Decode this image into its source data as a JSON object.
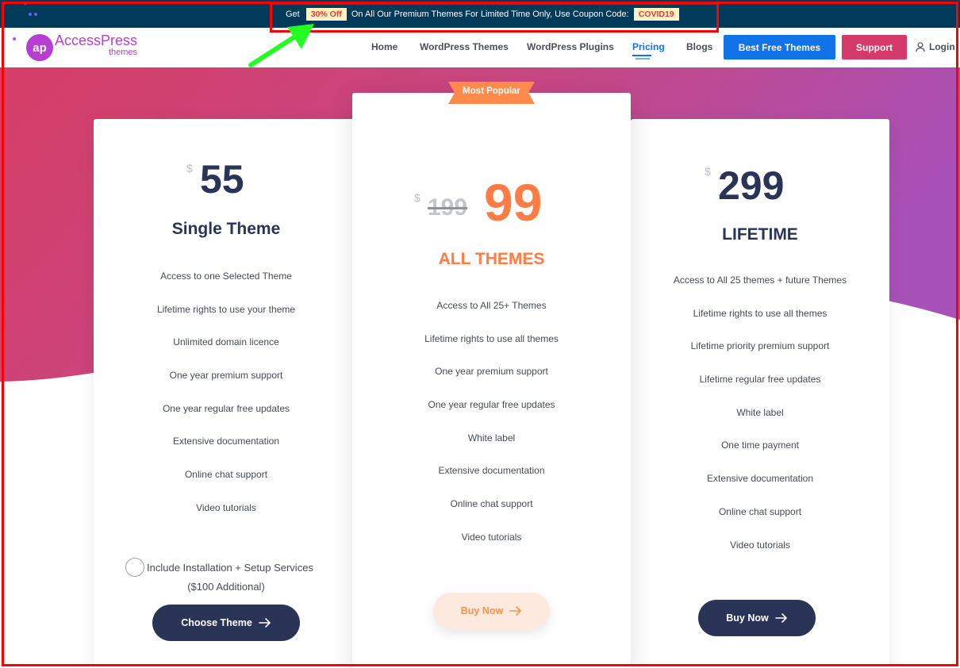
{
  "promo": {
    "prefix": "Get",
    "discount": "30% Off",
    "message": "On All Our Premium Themes For Limited Time Only, Use Coupon Code:",
    "coupon": "COVID19"
  },
  "logo": {
    "mark": "ap",
    "line1": "AccessPress",
    "line2": "themes"
  },
  "nav": {
    "items": [
      {
        "label": "Home"
      },
      {
        "label": "WordPress Themes"
      },
      {
        "label": "WordPress Plugins"
      },
      {
        "label": "Pricing"
      },
      {
        "label": "Blogs"
      }
    ],
    "active": "Pricing",
    "free_button": "Best Free Themes",
    "support_button": "Support",
    "login": "Login"
  },
  "plans": [
    {
      "currency": "$",
      "price": "55",
      "name": "Single Theme",
      "features": [
        "Access to one Selected Theme",
        "Lifetime rights to use your theme",
        "Unlimited domain licence",
        "One year premium support",
        "One year regular free updates",
        "Extensive documentation",
        "Online chat support",
        "Video tutorials"
      ],
      "addon_label": "Include Installation + Setup Services",
      "addon_price": "($100 Additional)",
      "button": "Choose Theme"
    },
    {
      "ribbon": "Most Popular",
      "currency": "$",
      "old_price": "199",
      "price": "99",
      "name": "ALL THEMES",
      "features": [
        "Access to All 25+ Themes",
        "Lifetime rights to use all themes",
        "One year premium support",
        "One year regular free updates",
        "White label",
        "Extensive documentation",
        "Online chat support",
        "Video tutorials"
      ],
      "button": "Buy Now"
    },
    {
      "currency": "$",
      "price": "299",
      "name": "LIFETIME",
      "features": [
        "Access to All 25 themes + future Themes",
        "Lifetime rights to use all themes",
        "Lifetime priority premium support",
        "Lifetime regular free updates",
        "White label",
        "One time payment",
        "Extensive documentation",
        "Online chat support",
        "Video tutorials"
      ],
      "button": "Buy Now"
    }
  ],
  "colors": {
    "topbar": "#023a5a",
    "primary": "#2a3457",
    "accent_orange": "#ff7c45",
    "blue": "#1273e8",
    "support": "#d53b6a",
    "hero_start": "#d63e67",
    "hero_end": "#a851b8"
  }
}
